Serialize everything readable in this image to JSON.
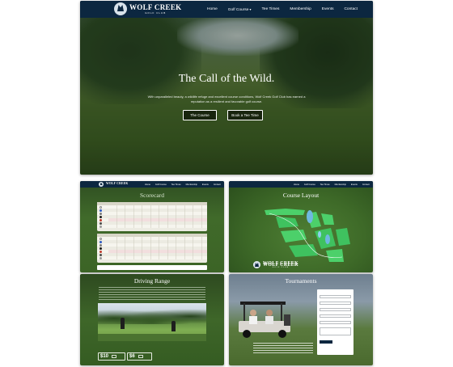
{
  "brand": {
    "name": "WOLF CREEK",
    "sub": "GOLF CLUB"
  },
  "nav": [
    "Home",
    "Golf Course",
    "Tee Times",
    "Membership",
    "Events",
    "Contact"
  ],
  "hero": {
    "title": "The Call of the Wild.",
    "lede": "With unparalleled beauty, a wildlife refuge and excellent course conditions, Wolf Creek Golf Club has earned a reputation as a resilient and favorable golf course.",
    "btn_course": "The Course",
    "btn_tee": "Book a Tee Time"
  },
  "pages": {
    "scorecard": "Scorecard",
    "layout": "Course Layout",
    "range": "Driving Range",
    "tournaments": "Tournaments"
  },
  "range": {
    "rate_1": "$10",
    "rate_2": "$6"
  },
  "colors": {
    "navy": "#0c2740",
    "grass": "#3e6a28"
  }
}
